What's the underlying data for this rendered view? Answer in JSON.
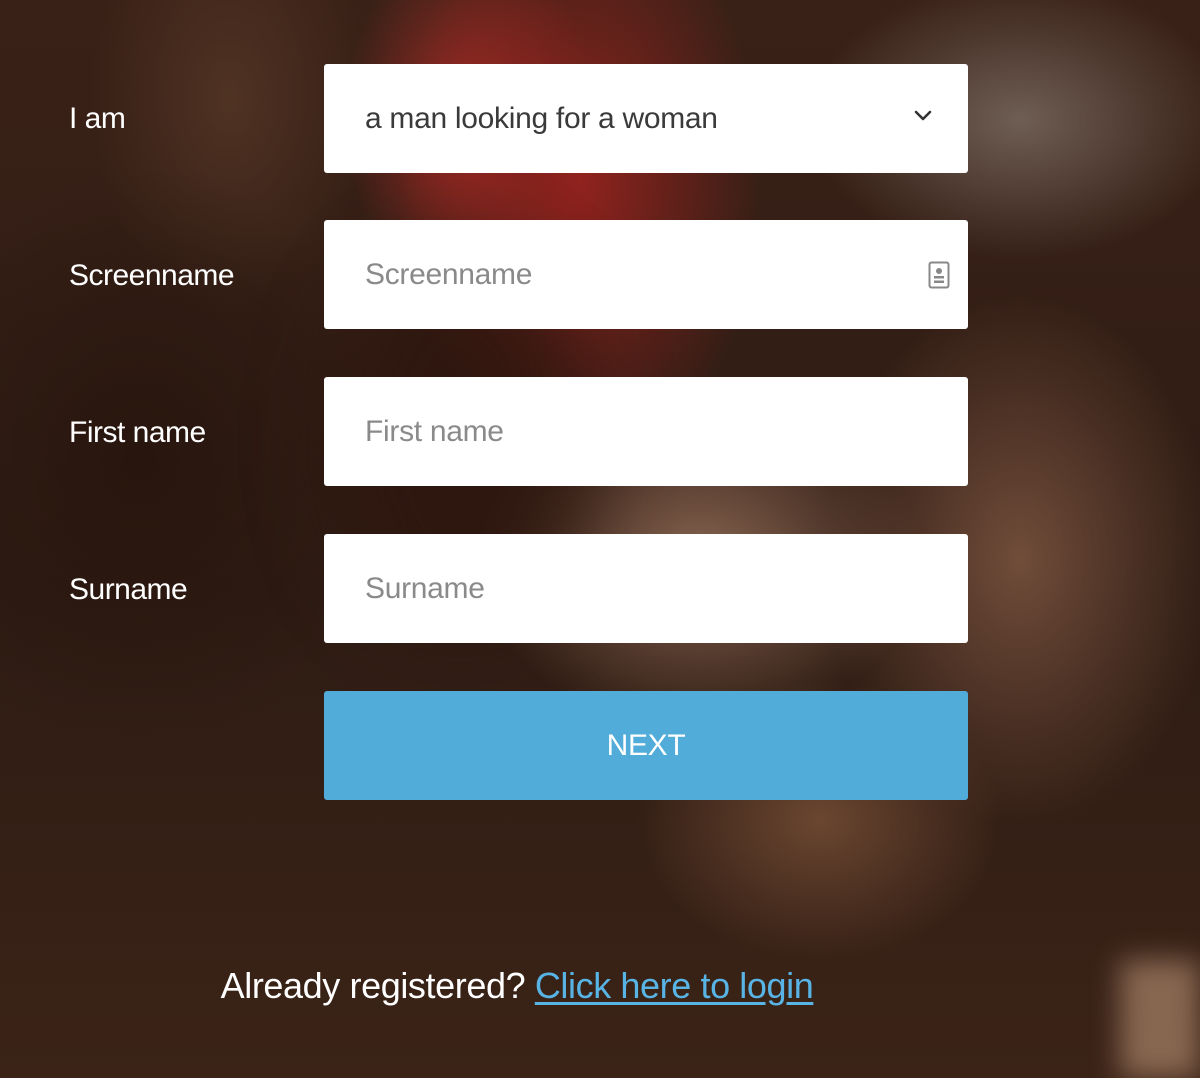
{
  "form": {
    "gender": {
      "label": "I am",
      "selected": "a man looking for a woman",
      "icon": "chevron-down-icon"
    },
    "screenname": {
      "label": "Screenname",
      "placeholder": "Screenname",
      "value": "",
      "icon": "contact-card-icon"
    },
    "first_name": {
      "label": "First name",
      "placeholder": "First name",
      "value": ""
    },
    "surname": {
      "label": "Surname",
      "placeholder": "Surname",
      "value": ""
    },
    "next_label": "NEXT"
  },
  "footer": {
    "prompt": "Already registered?",
    "link_text": "Click here to login"
  },
  "colors": {
    "button": "#52acd9",
    "link": "#59b4e6",
    "field_background": "#ffffff",
    "label_text": "#ffffff"
  }
}
